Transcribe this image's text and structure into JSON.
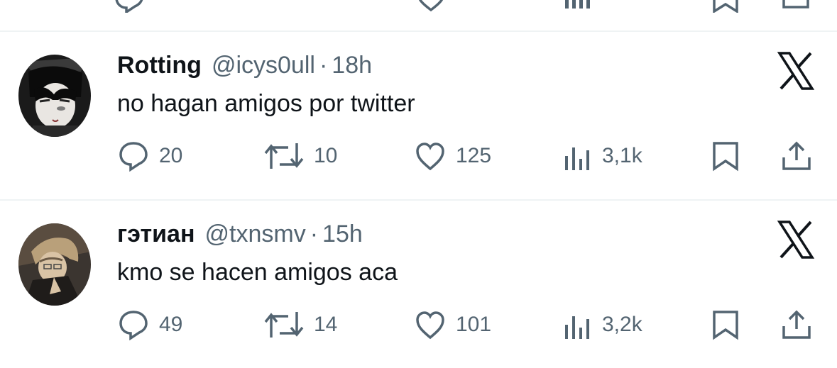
{
  "tweets": [
    {
      "name": "Rotting",
      "handle": "@icys0ull",
      "separator": "·",
      "time": "18h",
      "text": "no hagan amigos por twitter",
      "replies": "20",
      "retweets": "10",
      "likes": "125",
      "views": "3,1k"
    },
    {
      "name": "гэтиан",
      "handle": "@txnsmv",
      "separator": "·",
      "time": "15h",
      "text": "kmo se hacen amigos aca",
      "replies": "49",
      "retweets": "14",
      "likes": "101",
      "views": "3,2k"
    }
  ],
  "icons": {
    "reply": "reply-icon",
    "retweet": "retweet-icon",
    "like": "heart-icon",
    "views": "views-icon",
    "bookmark": "bookmark-icon",
    "share": "share-icon",
    "brand": "x-logo-icon"
  },
  "colors": {
    "text": "#0f1419",
    "secondary": "#536471",
    "divider": "#eff3f4"
  }
}
